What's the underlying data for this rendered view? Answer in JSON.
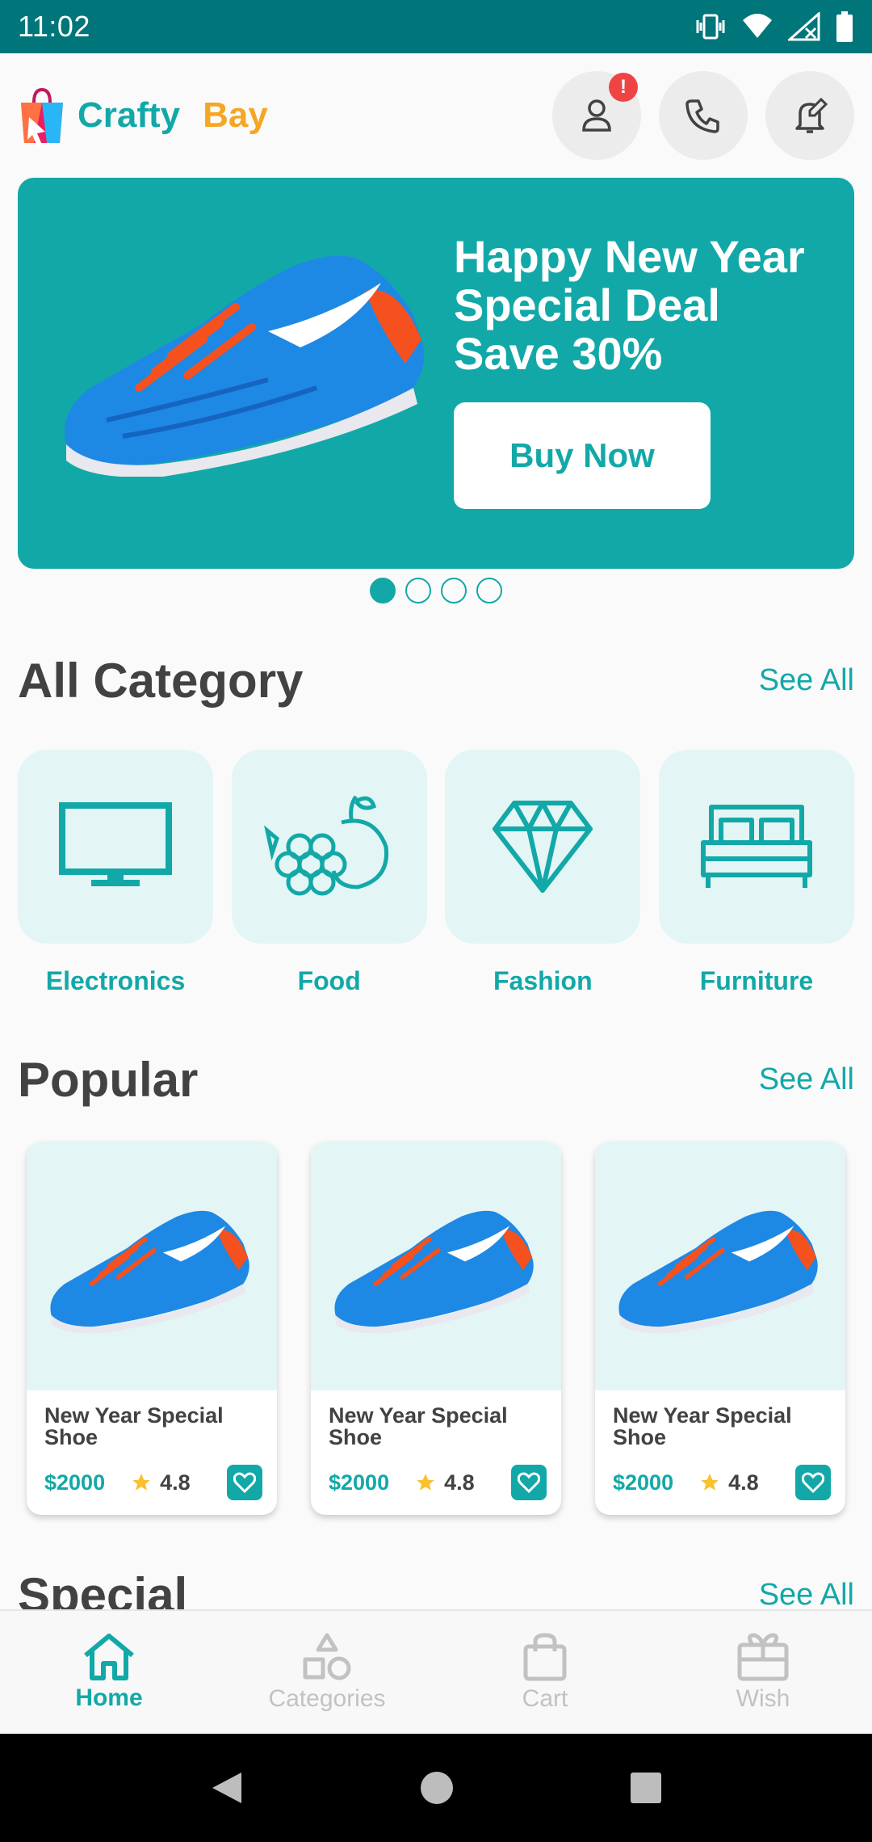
{
  "status_bar": {
    "time": "11:02"
  },
  "brand": {
    "part1": "Crafty",
    "part2": "Bay"
  },
  "header": {
    "notification_badge": "!"
  },
  "banner": {
    "headline_lines": [
      "Happy New Year",
      "Special Deal",
      "Save 30%"
    ],
    "button_label": "Buy Now",
    "slides_total": 4,
    "active_slide": 1
  },
  "categories_section": {
    "title": "All Category",
    "see_all": "See All",
    "items": [
      {
        "label": "Electronics",
        "icon": "monitor-icon"
      },
      {
        "label": "Food",
        "icon": "fruits-icon"
      },
      {
        "label": "Fashion",
        "icon": "diamond-icon"
      },
      {
        "label": "Furniture",
        "icon": "bed-icon"
      }
    ]
  },
  "popular_section": {
    "title": "Popular",
    "see_all": "See All",
    "products": [
      {
        "title": "New Year Special Shoe",
        "price": "$2000",
        "rating": "4.8"
      },
      {
        "title": "New Year Special Shoe",
        "price": "$2000",
        "rating": "4.8"
      },
      {
        "title": "New Year Special Shoe",
        "price": "$2000",
        "rating": "4.8"
      }
    ]
  },
  "special_section": {
    "title": "Special",
    "see_all": "See All"
  },
  "bottom_nav": {
    "items": [
      {
        "label": "Home",
        "icon": "home-icon",
        "active": true
      },
      {
        "label": "Categories",
        "icon": "categories-icon",
        "active": false
      },
      {
        "label": "Cart",
        "icon": "cart-icon",
        "active": false
      },
      {
        "label": "Wish",
        "icon": "gift-icon",
        "active": false
      }
    ]
  },
  "colors": {
    "primary": "#13a8a8",
    "accent": "#f5a623",
    "status_bar": "#00757a",
    "badge": "#ef4444"
  }
}
